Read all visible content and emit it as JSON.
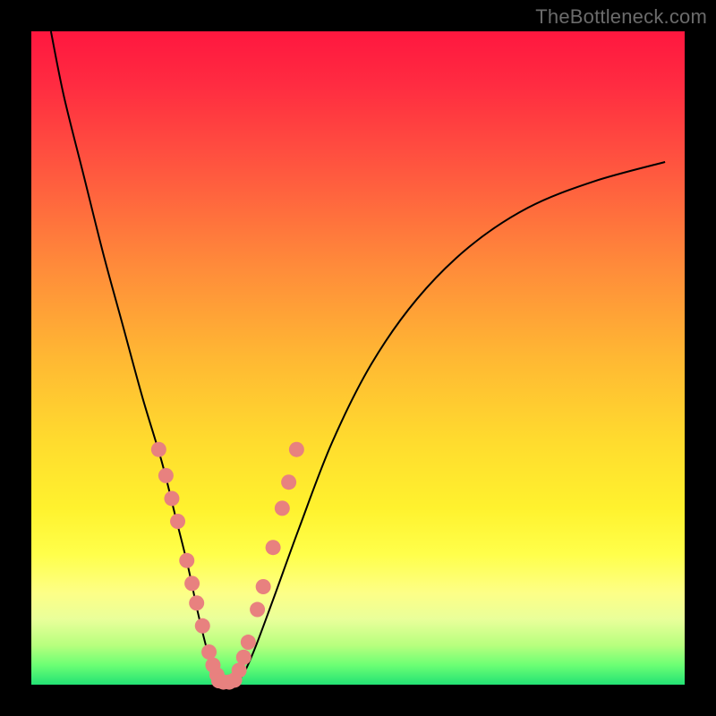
{
  "watermark": "TheBottleneck.com",
  "colors": {
    "dot": "#e8817f",
    "curve": "#000000",
    "frame": "#000000"
  },
  "chart_data": {
    "type": "line",
    "title": "",
    "xlabel": "",
    "ylabel": "",
    "xlim": [
      0,
      100
    ],
    "ylim": [
      0,
      100
    ],
    "grid": false,
    "legend": false,
    "series": [
      {
        "name": "bottleneck-curve",
        "x": [
          3,
          5,
          8,
          11,
          14,
          17,
          20,
          22,
          24,
          25.5,
          27,
          28.5,
          30,
          32,
          34,
          37,
          41,
          46,
          52,
          59,
          67,
          76,
          86,
          97
        ],
        "y": [
          100,
          90,
          78,
          66,
          55,
          44,
          34,
          26,
          18,
          11,
          5,
          1,
          0,
          1,
          5,
          13,
          24,
          37,
          49,
          59,
          67,
          73,
          77,
          80
        ]
      }
    ],
    "markers": [
      {
        "name": "left-dots",
        "x": [
          19.5,
          20.6,
          21.5,
          22.4,
          23.8,
          24.6,
          25.3,
          26.2,
          27.2,
          27.8,
          28.4
        ],
        "y": [
          36,
          32,
          28.5,
          25,
          19,
          15.5,
          12.5,
          9,
          5,
          3,
          1.5
        ]
      },
      {
        "name": "bottom-dots",
        "x": [
          28.7,
          29.4,
          30.3,
          31.1
        ],
        "y": [
          0.6,
          0.4,
          0.4,
          0.7
        ]
      },
      {
        "name": "right-dots",
        "x": [
          31.8,
          32.5,
          33.2,
          34.6,
          35.5,
          37.0,
          38.4,
          39.4,
          40.6
        ],
        "y": [
          2.2,
          4.2,
          6.5,
          11.5,
          15,
          21,
          27,
          31,
          36
        ]
      }
    ]
  }
}
